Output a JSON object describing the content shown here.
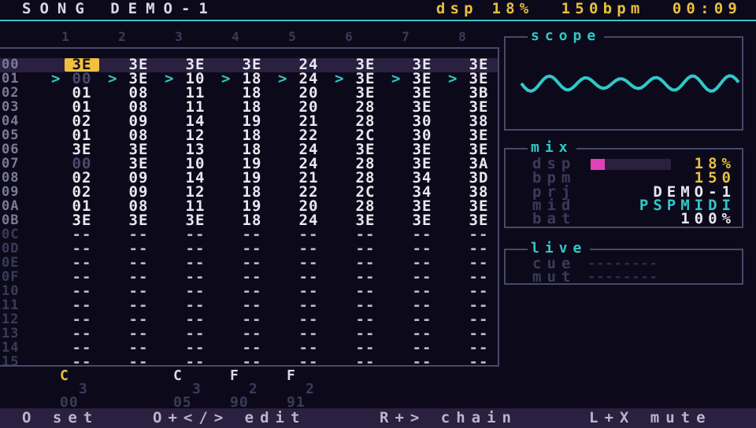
{
  "header": {
    "title": "SONG DEMO-1",
    "dsp": "dsp 18%",
    "bpm": "150bpm",
    "time": "00:09"
  },
  "columns": [
    "1",
    "2",
    "3",
    "4",
    "5",
    "6",
    "7",
    "8"
  ],
  "rows": [
    {
      "n": "00",
      "cells": [
        "3E",
        "3E",
        "3E",
        "3E",
        "24",
        "3E",
        "3E",
        "3E"
      ]
    },
    {
      "n": "01",
      "cells": [
        "00",
        "3E",
        "10",
        "18",
        "24",
        "3E",
        "3E",
        "3E"
      ]
    },
    {
      "n": "02",
      "cells": [
        "01",
        "08",
        "11",
        "18",
        "20",
        "3E",
        "3E",
        "3B"
      ]
    },
    {
      "n": "03",
      "cells": [
        "01",
        "08",
        "11",
        "18",
        "20",
        "28",
        "3E",
        "3E"
      ]
    },
    {
      "n": "04",
      "cells": [
        "02",
        "09",
        "14",
        "19",
        "21",
        "28",
        "30",
        "38"
      ]
    },
    {
      "n": "05",
      "cells": [
        "01",
        "08",
        "12",
        "18",
        "22",
        "2C",
        "30",
        "3E"
      ]
    },
    {
      "n": "06",
      "cells": [
        "3E",
        "3E",
        "13",
        "18",
        "24",
        "3E",
        "3E",
        "3E"
      ]
    },
    {
      "n": "07",
      "cells": [
        "00",
        "3E",
        "10",
        "19",
        "24",
        "28",
        "3E",
        "3A"
      ]
    },
    {
      "n": "08",
      "cells": [
        "02",
        "09",
        "14",
        "19",
        "21",
        "28",
        "34",
        "3D"
      ]
    },
    {
      "n": "09",
      "cells": [
        "02",
        "09",
        "12",
        "18",
        "22",
        "2C",
        "34",
        "38"
      ]
    },
    {
      "n": "0A",
      "cells": [
        "01",
        "08",
        "11",
        "19",
        "20",
        "28",
        "3E",
        "3E"
      ]
    },
    {
      "n": "0B",
      "cells": [
        "3E",
        "3E",
        "3E",
        "18",
        "24",
        "3E",
        "3E",
        "3E"
      ]
    },
    {
      "n": "0C",
      "cells": [
        "--",
        "--",
        "--",
        "--",
        "--",
        "--",
        "--",
        "--"
      ]
    },
    {
      "n": "0D",
      "cells": [
        "--",
        "--",
        "--",
        "--",
        "--",
        "--",
        "--",
        "--"
      ]
    },
    {
      "n": "0E",
      "cells": [
        "--",
        "--",
        "--",
        "--",
        "--",
        "--",
        "--",
        "--"
      ]
    },
    {
      "n": "0F",
      "cells": [
        "--",
        "--",
        "--",
        "--",
        "--",
        "--",
        "--",
        "--"
      ]
    },
    {
      "n": "10",
      "cells": [
        "--",
        "--",
        "--",
        "--",
        "--",
        "--",
        "--",
        "--"
      ]
    },
    {
      "n": "11",
      "cells": [
        "--",
        "--",
        "--",
        "--",
        "--",
        "--",
        "--",
        "--"
      ]
    },
    {
      "n": "12",
      "cells": [
        "--",
        "--",
        "--",
        "--",
        "--",
        "--",
        "--",
        "--"
      ]
    },
    {
      "n": "13",
      "cells": [
        "--",
        "--",
        "--",
        "--",
        "--",
        "--",
        "--",
        "--"
      ]
    },
    {
      "n": "14",
      "cells": [
        "--",
        "--",
        "--",
        "--",
        "--",
        "--",
        "--",
        "--"
      ]
    },
    {
      "n": "15",
      "cells": [
        "--",
        "--",
        "--",
        "--",
        "--",
        "--",
        "--",
        "--"
      ]
    }
  ],
  "scope": {
    "title": "scope"
  },
  "mix": {
    "title": "mix",
    "labels": {
      "dsp": "dsp",
      "bpm": "bpm",
      "prj": "prj",
      "mid": "mid",
      "bat": "bat"
    },
    "values": {
      "dsp": "18%",
      "bpm": "150",
      "prj": "DEMO-1",
      "mid": "PSPMIDI",
      "bat": "100%"
    },
    "dsp_level": 0.18
  },
  "live": {
    "title": "live",
    "cue_label": "cue",
    "mut_label": "mut",
    "cue_value": "--------",
    "mut_value": "--------"
  },
  "chain": {
    "c1": {
      "top": "C",
      "mid": "3",
      "bot": "00"
    },
    "c3": {
      "top": "C",
      "mid": "3",
      "bot": "05"
    },
    "c4": {
      "top": "F",
      "mid": "2",
      "bot": "90"
    },
    "c5": {
      "top": "F",
      "mid": "2",
      "bot": "91"
    }
  },
  "footer": {
    "h1": "O set",
    "h2": "O+</> edit",
    "h3": "R+> chain",
    "h4": "L+X mute"
  },
  "colors": {
    "accent": "#30c8c8",
    "yellow": "#e8c040",
    "magenta": "#e040b8",
    "text": "#e8e8f0",
    "dim": "#3a3a5a"
  }
}
